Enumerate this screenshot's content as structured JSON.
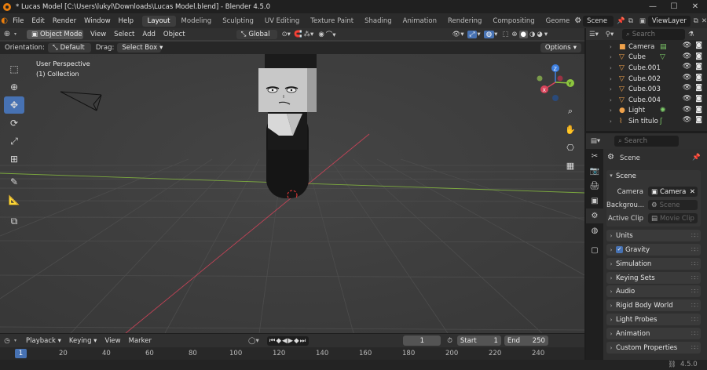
{
  "title_bar": {
    "title": "* Lucas Model [C:\\Users\\lukyl\\Downloads\\Lucas Model.blend] - Blender 4.5.0",
    "minimize": "—",
    "maximize": "☐",
    "close": "✕"
  },
  "menu": {
    "items": [
      "File",
      "Edit",
      "Render",
      "Window",
      "Help"
    ]
  },
  "workspaces": {
    "tabs": [
      "Layout",
      "Modeling",
      "Sculpting",
      "UV Editing",
      "Texture Paint",
      "Shading",
      "Animation",
      "Rendering",
      "Compositing",
      "Geome"
    ],
    "active": "Layout",
    "scene": "Scene",
    "view_layer": "ViewLayer"
  },
  "viewport_header": {
    "mode": "Object Mode",
    "menus": [
      "View",
      "Select",
      "Add",
      "Object"
    ],
    "transform_orientation": "Global",
    "orientation_label": "Orientation:",
    "orientation_value": "Default",
    "drag_label": "Drag:",
    "drag_value": "Select Box",
    "options": "Options"
  },
  "viewport": {
    "perspective": "User Perspective",
    "collection": "(1) Collection",
    "gizmo_axes": [
      "X",
      "Y",
      "Z"
    ]
  },
  "outliner": {
    "search_placeholder": "Search",
    "items": [
      {
        "name": "Camera",
        "icon": "camera-object-icon"
      },
      {
        "name": "Cube",
        "icon": "mesh-object-icon"
      },
      {
        "name": "Cube.001",
        "icon": "mesh-object-icon"
      },
      {
        "name": "Cube.002",
        "icon": "mesh-object-icon"
      },
      {
        "name": "Cube.003",
        "icon": "mesh-object-icon"
      },
      {
        "name": "Cube.004",
        "icon": "mesh-object-icon"
      },
      {
        "name": "Light",
        "icon": "light-object-icon"
      },
      {
        "name": "Sin título",
        "icon": "curve-object-icon"
      }
    ]
  },
  "properties": {
    "search_placeholder": "Search",
    "context": "Scene",
    "scene_panel": {
      "title": "Scene",
      "camera_label": "Camera",
      "camera_value": "Camera",
      "background_label": "Backgrou...",
      "background_value": "Scene",
      "clip_label": "Active Clip",
      "clip_value": "Movie Clip"
    },
    "panels": [
      "Units",
      "Gravity",
      "Simulation",
      "Keying Sets",
      "Audio",
      "Rigid Body World",
      "Light Probes",
      "Animation",
      "Custom Properties"
    ],
    "gravity_checked": true
  },
  "timeline": {
    "menus": [
      "Playback",
      "Keying",
      "View",
      "Marker"
    ],
    "current_frame": "1",
    "start_label": "Start",
    "start_value": "1",
    "end_label": "End",
    "end_value": "250",
    "ruler_ticks": [
      "1",
      "20",
      "40",
      "60",
      "80",
      "100",
      "120",
      "140",
      "160",
      "180",
      "200",
      "220",
      "240"
    ]
  },
  "status_bar": {
    "version": "4.5.0"
  },
  "colors": {
    "accent": "#4772b3",
    "x_axis": "#d9445b",
    "y_axis": "#8dc63f",
    "z_axis": "#3d7fe0",
    "object_orange": "#f0a24b"
  }
}
